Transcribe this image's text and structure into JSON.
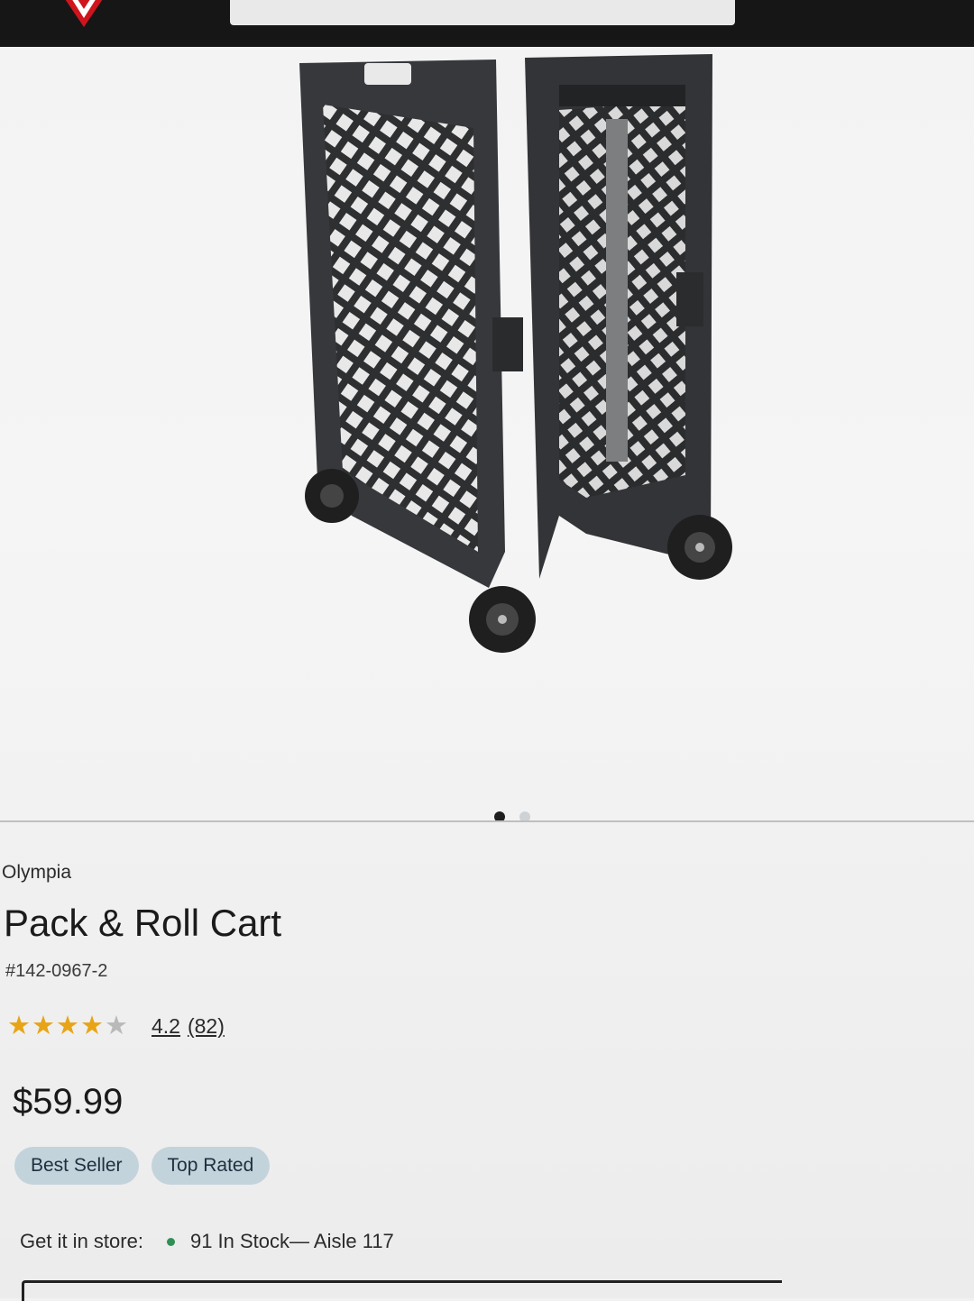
{
  "product": {
    "brand": "Olympia",
    "title": "Pack & Roll Cart",
    "sku": "#142-0967-2",
    "rating": {
      "value": "4.2",
      "count": "(82)",
      "stars": 4.2,
      "max_stars": 5
    },
    "price": "$59.99",
    "badges": [
      "Best Seller",
      "Top Rated"
    ],
    "in_store": {
      "label": "Get it in store:",
      "status": "91 In Stock— Aisle 117"
    }
  },
  "gallery": {
    "image_count": 2,
    "active_index": 0
  },
  "colors": {
    "header": "#161616",
    "badge_bg": "#c3d3db",
    "star": "#e7a417",
    "stock_dot": "#2f8f55",
    "logo_red": "#d0141e"
  }
}
